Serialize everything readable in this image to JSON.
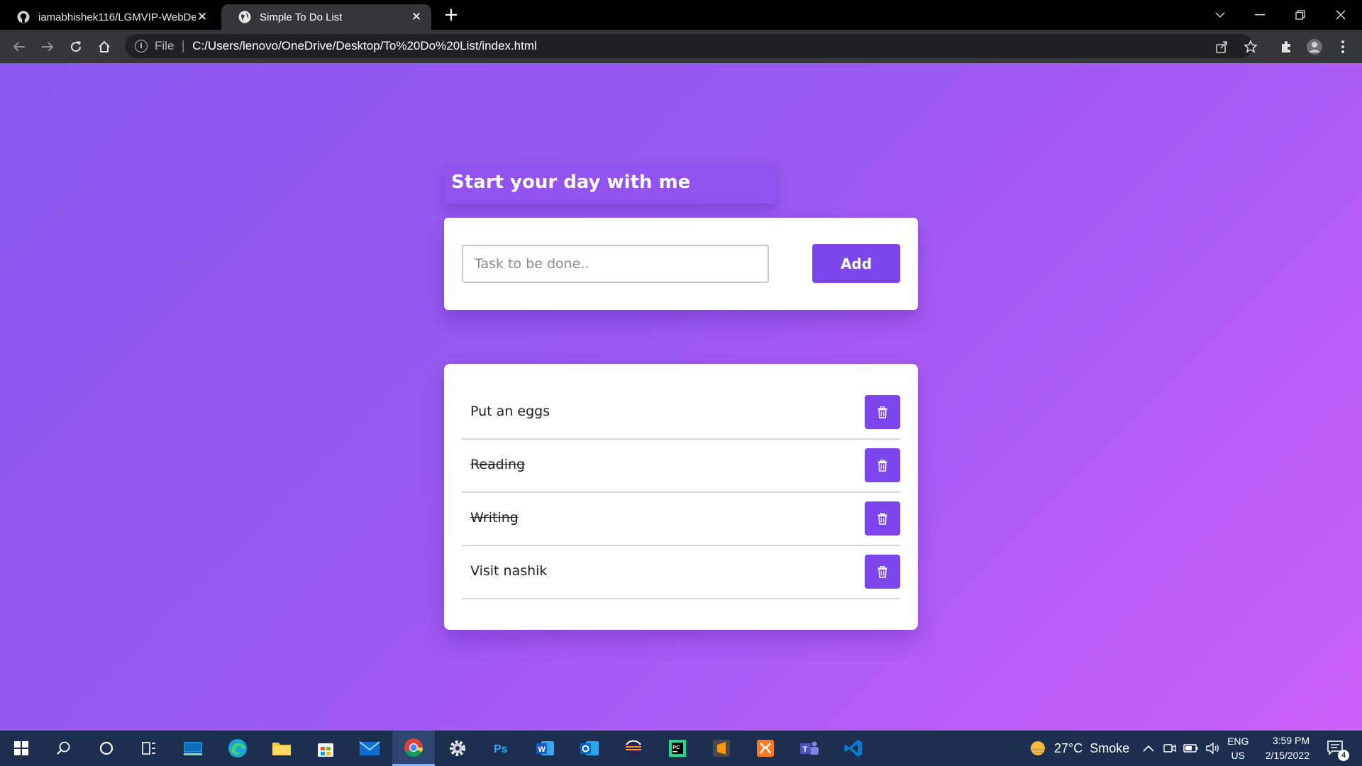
{
  "browser": {
    "tabs": [
      {
        "title": "iamabhishek116/LGMVIP-WebDe",
        "icon": "github-icon"
      },
      {
        "title": "Simple To Do List",
        "icon": "globe-icon"
      }
    ],
    "address": {
      "scheme": "File",
      "url": "C:/Users/lenovo/OneDrive/Desktop/To%20Do%20List/index.html"
    }
  },
  "app": {
    "heading": "Start your day with me",
    "input": {
      "placeholder": "Task to be done..",
      "value": ""
    },
    "add_label": "Add",
    "tasks": [
      {
        "text": "Put an eggs",
        "done": false
      },
      {
        "text": "Reading",
        "done": true
      },
      {
        "text": "Writing",
        "done": true
      },
      {
        "text": "Visit nashik",
        "done": false
      }
    ],
    "colors": {
      "accent": "#7d45ec",
      "background_start": "#8a58ef",
      "background_end": "#cc60fb"
    }
  },
  "taskbar": {
    "apps": [
      "windows-start",
      "search",
      "cortana",
      "task-view",
      "desktop",
      "edge",
      "file-explorer",
      "microsoft-store",
      "mail",
      "chrome",
      "settings",
      "photoshop",
      "word",
      "outlook",
      "eclipse",
      "pycharm",
      "sublime-text",
      "xampp",
      "teams",
      "vscode"
    ],
    "weather": {
      "temp": "27°C",
      "condition": "Smoke"
    },
    "language": {
      "lang": "ENG",
      "region": "US"
    },
    "clock": {
      "time": "3:59 PM",
      "date": "2/15/2022"
    },
    "notifications": "4"
  }
}
